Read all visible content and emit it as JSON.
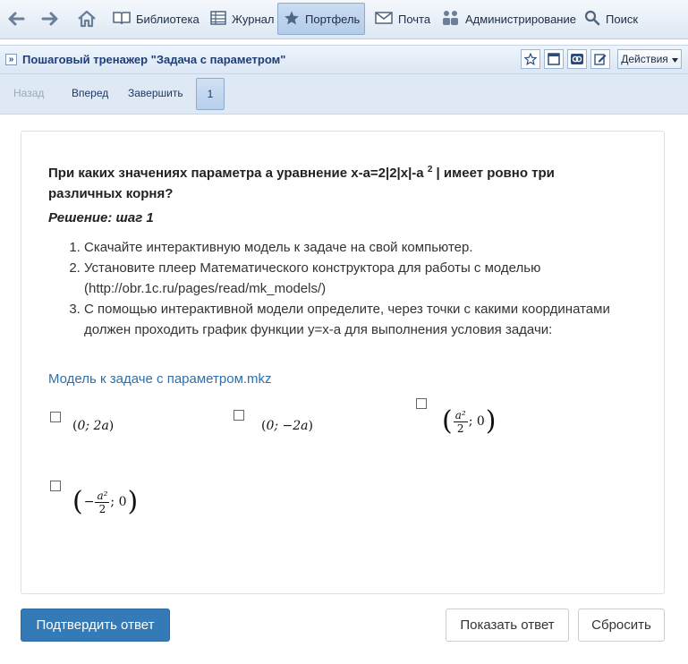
{
  "nav": {
    "items": [
      {
        "label": "Библиотека",
        "icon": "book-icon"
      },
      {
        "label": "Журнал",
        "icon": "journal-grid-icon"
      },
      {
        "label": "Портфель",
        "icon": "star-icon",
        "active": true
      },
      {
        "label": "Почта",
        "icon": "mail-icon"
      },
      {
        "label": "Администрирование",
        "icon": "admin-users-icon"
      },
      {
        "label": "Поиск",
        "icon": "magnifier-icon"
      }
    ]
  },
  "titlebar": {
    "title": "Пошаговый тренажер \"Задача с параметром\"",
    "actions_label": "Действия"
  },
  "toolbar": {
    "back": "Назад",
    "forward": "Вперед",
    "finish": "Завершить",
    "page": "1"
  },
  "task": {
    "question": "При каких значениях параметра а уравнение x-a=2|2|x|-a",
    "question_sup": "2",
    "question_tail": "| имеет ровно три различных корня?",
    "step_title": "Решение: шаг 1",
    "steps": [
      "Скачайте интерактивную модель к задаче на свой компьютер.",
      "Установите плеер Математического конструктора для работы с моделью (http://obr.1c.ru/pages/read/mk_models/)",
      "С помощью интерактивной модели определите, через точки с какими координатами должен проходить график функции y=x-a для выполнения условия задачи:"
    ],
    "model_link": "Модель к задаче с параметром.mkz",
    "options": [
      {
        "text": "(0; 2a)",
        "checked": false
      },
      {
        "text": "(0; −2a)",
        "checked": false
      },
      {
        "text": "(a²/2; 0)",
        "num": "a²",
        "den": "2",
        "tail": "; 0",
        "checked": false
      },
      {
        "text": "(−a²/2; 0)",
        "minus": "−",
        "num": "a²",
        "den": "2",
        "tail": "; 0",
        "checked": false
      }
    ]
  },
  "buttons": {
    "confirm": "Подтвердить ответ",
    "show_answer": "Показать ответ",
    "reset": "Сбросить"
  },
  "colors": {
    "primary": "#337ab7",
    "link": "#2f6fa9",
    "nav_active": "#b3cce8"
  }
}
